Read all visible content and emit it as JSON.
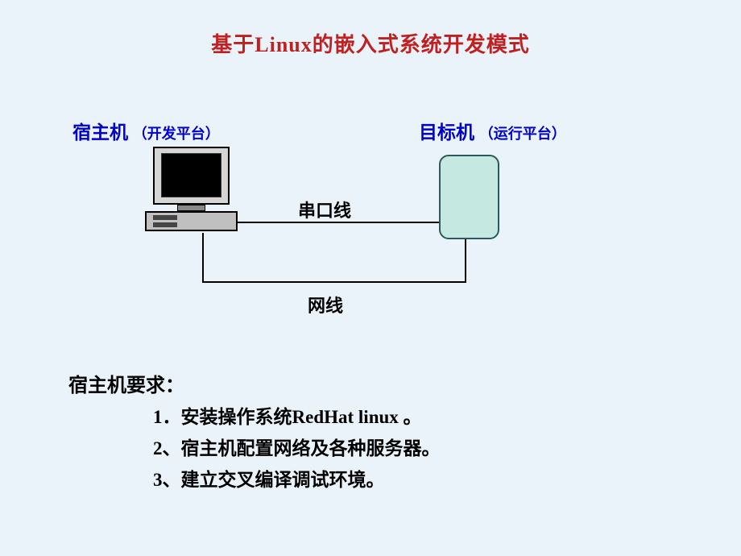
{
  "title": "基于Linux的嵌入式系统开发模式",
  "hostLabel": "宿主机",
  "hostSublabel": "（开发平台）",
  "targetLabel": "目标机",
  "targetSublabel": "（运行平台）",
  "serialLine": "串口线",
  "netLine": "网线",
  "reqTitle": "宿主机要求：",
  "requirements": {
    "item1": "1．安装操作系统RedHat linux 。",
    "item2": "2、宿主机配置网络及各种服务器。",
    "item3": "3、建立交叉编译调试环境。"
  }
}
